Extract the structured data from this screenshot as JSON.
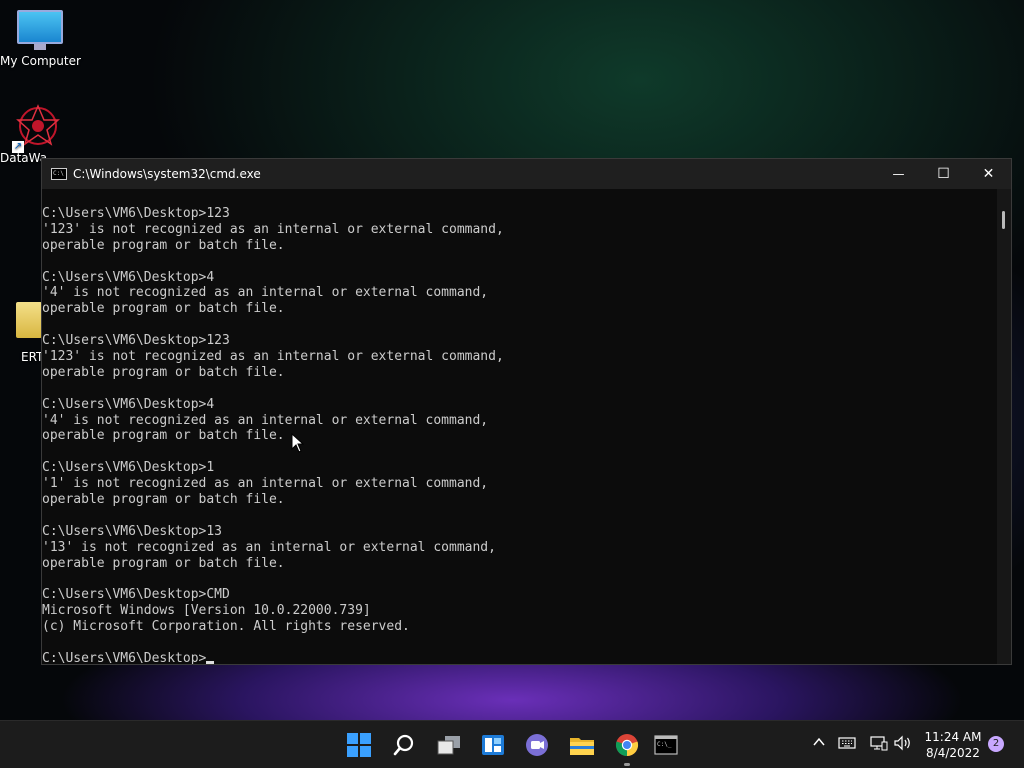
{
  "desktop": {
    "icons": [
      {
        "label": "My Computer",
        "icon": "monitor-icon"
      },
      {
        "label": "DataWa",
        "icon": "datawa-app-icon"
      },
      {
        "label": "ERT",
        "icon": "folder-icon"
      }
    ]
  },
  "window": {
    "title": "C:\\Windows\\system32\\cmd.exe",
    "minimize_glyph": "—",
    "maximize_glyph": "☐",
    "close_glyph": "✕",
    "console_lines": [
      "C:\\Users\\VM6\\Desktop>123",
      "'123' is not recognized as an internal or external command,",
      "operable program or batch file.",
      "",
      "C:\\Users\\VM6\\Desktop>4",
      "'4' is not recognized as an internal or external command,",
      "operable program or batch file.",
      "",
      "C:\\Users\\VM6\\Desktop>123",
      "'123' is not recognized as an internal or external command,",
      "operable program or batch file.",
      "",
      "C:\\Users\\VM6\\Desktop>4",
      "'4' is not recognized as an internal or external command,",
      "operable program or batch file.",
      "",
      "C:\\Users\\VM6\\Desktop>1",
      "'1' is not recognized as an internal or external command,",
      "operable program or batch file.",
      "",
      "C:\\Users\\VM6\\Desktop>13",
      "'13' is not recognized as an internal or external command,",
      "operable program or batch file.",
      "",
      "C:\\Users\\VM6\\Desktop>CMD",
      "Microsoft Windows [Version 10.0.22000.739]",
      "(c) Microsoft Corporation. All rights reserved.",
      ""
    ],
    "prompt": "C:\\Users\\VM6\\Desktop>"
  },
  "taskbar": {
    "apps": [
      "start-icon",
      "search-icon",
      "task-view-icon",
      "widgets-icon",
      "teams-chat-icon",
      "file-explorer-icon",
      "chrome-icon",
      "terminal-icon"
    ],
    "tray": {
      "chevron": "^",
      "time": "11:24 AM",
      "date": "8/4/2022",
      "notifications": "2"
    }
  },
  "colors": {
    "console_bg": "#0c0c0c",
    "console_text": "#cccccc",
    "taskbar_bg": "#1c1c1c"
  }
}
